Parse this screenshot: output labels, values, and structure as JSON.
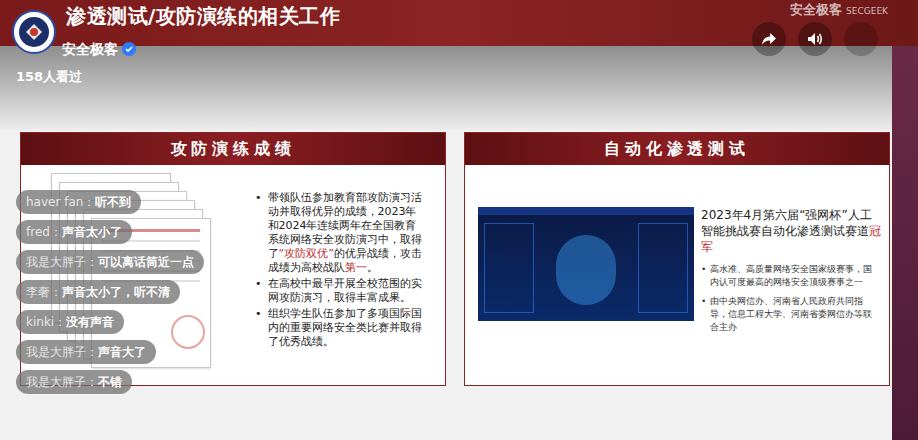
{
  "header": {
    "title": "渗透测试/攻防演练的相关工作"
  },
  "channel": {
    "name": "安全极客",
    "verified": true,
    "views": "158人看过"
  },
  "watermark": [
    "安全极客",
    "SECGEEK"
  ],
  "cards": [
    {
      "title": "攻防演练成绩",
      "bullet_mark": "•",
      "bullets": [
        [
          {
            "text": "带领队伍参加教育部攻防演习活动并取得优异的成绩，2023年和2024年连续两年在全国教育系统网络安全攻防演习中，取得了",
            "highlight": false
          },
          {
            "text": "“攻防双优”",
            "highlight": true
          },
          {
            "text": "的优异战绩，攻击成绩为高校战队",
            "highlight": false
          },
          {
            "text": "第一",
            "highlight": true
          },
          {
            "text": "。",
            "highlight": false
          }
        ],
        [
          {
            "text": "在高校中最早开展全校范围的实网攻防演习，取得丰富成果。",
            "highlight": false
          }
        ],
        [
          {
            "text": "组织学生队伍参加了多项国际国内的重要网络安全类比赛并取得了优秀战绩。",
            "highlight": false
          }
        ]
      ]
    },
    {
      "title": "自动化渗透测试",
      "bullet_mark": "•",
      "headline": [
        {
          "text": "2023年4月第六届“强网杯”人工智能挑战赛自动化渗透测试赛道",
          "highlight": false
        },
        {
          "text": "冠军",
          "highlight": true
        }
      ],
      "bullets": [
        "高水准、高质量网络安全国家级赛事，国内认可度最高的网络安全顶级赛事之一",
        "由中央网信办、河南省人民政府共同指导，信息工程大学、河南省委网信办等联合主办"
      ]
    }
  ],
  "danmaku": [
    {
      "user": "haver fan：",
      "text": "听不到"
    },
    {
      "user": "fred：",
      "text": "声音太小了"
    },
    {
      "user": "我是大胖子：",
      "text": "可以离话筒近一点"
    },
    {
      "user": "李奢：",
      "text": "声音太小了，听不清"
    },
    {
      "user": "kinki：",
      "text": "没有声音"
    },
    {
      "user": "我是大胖子：",
      "text": "声音大了"
    },
    {
      "user": "我是大胖子：",
      "text": "不错"
    }
  ]
}
